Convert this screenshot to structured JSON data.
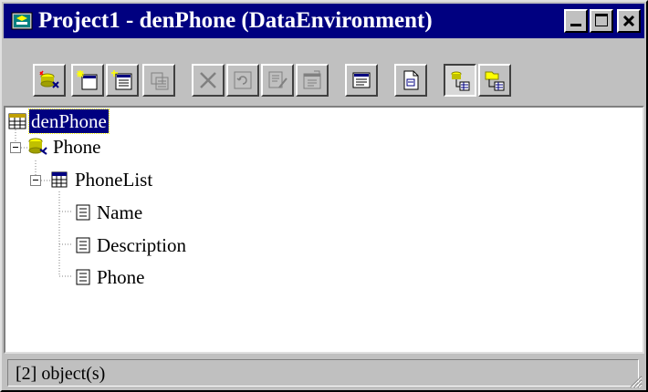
{
  "window": {
    "title": "Project1 - denPhone (DataEnvironment)"
  },
  "caption_buttons": [
    "minimize",
    "maximize",
    "close"
  ],
  "toolbar": {
    "buttons": [
      {
        "icon": "add-connection-icon",
        "enabled": true
      },
      {
        "icon": "add-command-icon",
        "enabled": true
      },
      {
        "icon": "insert-stored-procedure-icon",
        "enabled": true
      },
      {
        "icon": "add-child-command-icon",
        "enabled": false
      },
      {
        "icon": "delete-icon",
        "enabled": false
      },
      {
        "icon": "refresh-icon",
        "enabled": false
      },
      {
        "icon": "design-icon",
        "enabled": false
      },
      {
        "icon": "properties-icon",
        "enabled": false
      },
      {
        "icon": "view-code-icon",
        "enabled": true
      },
      {
        "icon": "options-icon",
        "enabled": true
      },
      {
        "icon": "arrange-by-connections-icon",
        "enabled": true,
        "pressed": true
      },
      {
        "icon": "arrange-by-objects-icon",
        "enabled": true
      }
    ]
  },
  "tree": {
    "root": {
      "label": "denPhone",
      "selected": true
    },
    "connection": {
      "label": "Phone",
      "expanded": true
    },
    "command": {
      "label": "PhoneList",
      "expanded": true
    },
    "fields": [
      {
        "label": "Name"
      },
      {
        "label": "Description"
      },
      {
        "label": "Phone"
      }
    ]
  },
  "status": {
    "text": "[2] object(s)"
  }
}
